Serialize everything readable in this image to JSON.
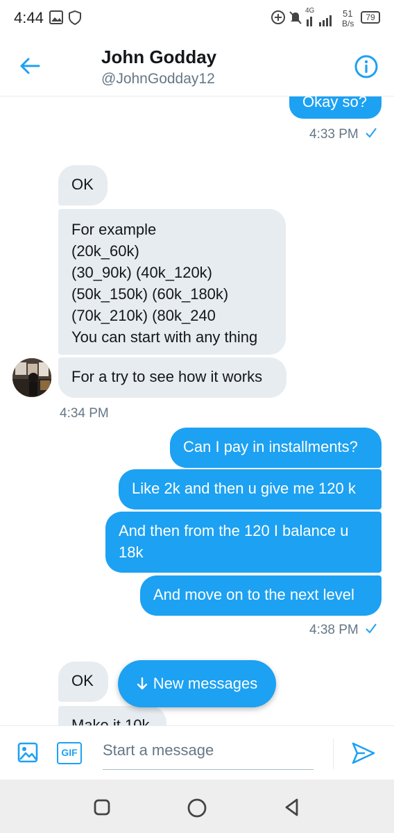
{
  "status_bar": {
    "time": "4:44",
    "network_type": "4G",
    "speed_value": "51",
    "speed_unit": "B/s",
    "battery": "79"
  },
  "header": {
    "name": "John Godday",
    "handle": "@JohnGodday12"
  },
  "messages": [
    {
      "direction": "out",
      "text": "Okay so?"
    },
    {
      "direction": "out",
      "timestamp": "4:33 PM"
    },
    {
      "direction": "in",
      "text": "OK"
    },
    {
      "direction": "in",
      "lines": [
        "For example",
        "(20k_60k)",
        "(30_90k) (40k_120k)",
        "(50k_150k) (60k_180k)",
        "(70k_210k) (80k_240",
        "You can start with any thing"
      ]
    },
    {
      "direction": "in",
      "text": "For a try to see how it works"
    },
    {
      "direction": "in",
      "timestamp": "4:34 PM"
    },
    {
      "direction": "out",
      "text": "Can I pay in installments?"
    },
    {
      "direction": "out",
      "text": "Like 2k and then u give me 120 k"
    },
    {
      "direction": "out",
      "lines": [
        "And then from the 120 I balance u",
        "18k"
      ]
    },
    {
      "direction": "out",
      "text": "And move on to the next level"
    },
    {
      "direction": "out",
      "timestamp": "4:38 PM"
    },
    {
      "direction": "in",
      "text": "OK"
    },
    {
      "direction": "in",
      "text": "Make it 10k"
    }
  ],
  "new_messages_label": "New messages",
  "composer": {
    "gif_label": "GIF",
    "placeholder": "Start a message"
  },
  "icons": {
    "back": "arrow-left-icon",
    "info": "info-icon",
    "image": "image-icon",
    "gif": "gif-icon",
    "send": "send-icon",
    "read_receipt": "checkmark-icon",
    "nav_recents": "square-icon",
    "nav_home": "circle-icon",
    "nav_back": "triangle-back-icon"
  },
  "colors": {
    "accent": "#1da1f2",
    "incoming_bubble": "#e6ecf0",
    "secondary_text": "#657786"
  }
}
